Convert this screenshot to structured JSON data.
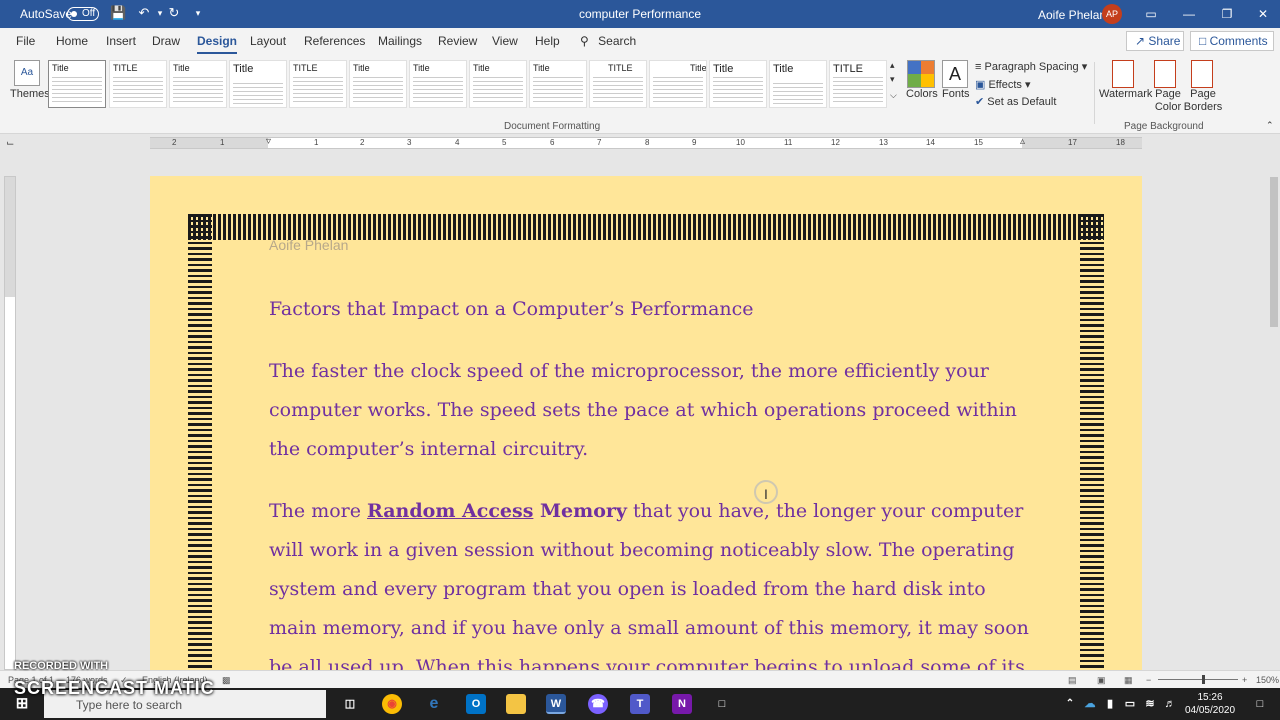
{
  "titlebar": {
    "autosave_label": "AutoSave",
    "autosave_state": "Off",
    "doc_title": "computer Performance",
    "user_name": "Aoife Phelan",
    "user_initials": "AP"
  },
  "tabs": [
    "File",
    "Home",
    "Insert",
    "Draw",
    "Design",
    "Layout",
    "References",
    "Mailings",
    "Review",
    "View",
    "Help"
  ],
  "active_tab": "Design",
  "search_label": "Search",
  "share_label": "Share",
  "comments_label": "Comments",
  "ribbon": {
    "themes_label": "Themes",
    "style_thumbs": [
      "Title",
      "TITLE",
      "Title",
      "Title",
      "TITLE",
      "Title",
      "Title",
      "Title",
      "Title",
      "TITLE",
      "Title",
      "Title",
      "Title",
      "TITLE"
    ],
    "colors_label": "Colors",
    "fonts_label": "Fonts",
    "paragraph_spacing_label": "Paragraph Spacing",
    "effects_label": "Effects",
    "set_default_label": "Set as Default",
    "doc_formatting_label": "Document Formatting",
    "watermark_label": "Watermark",
    "page_color_label": "Page Color",
    "page_borders_label": "Page Borders",
    "page_background_label": "Page Background"
  },
  "ruler_numbers": [
    "2",
    "1",
    "1",
    "1",
    "2",
    "3",
    "4",
    "5",
    "6",
    "7",
    "8",
    "9",
    "10",
    "11",
    "12",
    "13",
    "14",
    "15",
    "16",
    "17",
    "18"
  ],
  "document": {
    "header": "Aoife Phelan",
    "heading": "Factors that Impact on a Computer’s Performance",
    "para1": "The faster the clock speed of the microprocessor, the more efficiently your computer works. The speed sets the pace at which operations proceed within the computer’s internal circuitry.",
    "para2_start": "The more ",
    "para2_link": "Random Access",
    "para2_bold": " Memory",
    "para2_rest": " that you have, the longer your computer will work in a given session without becoming noticeably slow. The operating system and every program that you open is loaded from the hard disk into main memory, and if you have only a small amount of this memory, it may soon be all used up. When this happens your computer begins to unload some of its unwanted data into"
  },
  "status": {
    "page": "Page 1 of 1",
    "words": "176 words",
    "language": "English (Ireland)",
    "zoom": "150%"
  },
  "taskbar": {
    "search_placeholder": "Type here to search",
    "time": "15:26",
    "date": "04/05/2020"
  },
  "watermark": {
    "line1": "RECORDED WITH",
    "line2": "SCREENCAST MATIC"
  },
  "colors": {
    "word_blue": "#2b579a",
    "page_color": "#ffe699",
    "text_purple": "#7030a0"
  }
}
